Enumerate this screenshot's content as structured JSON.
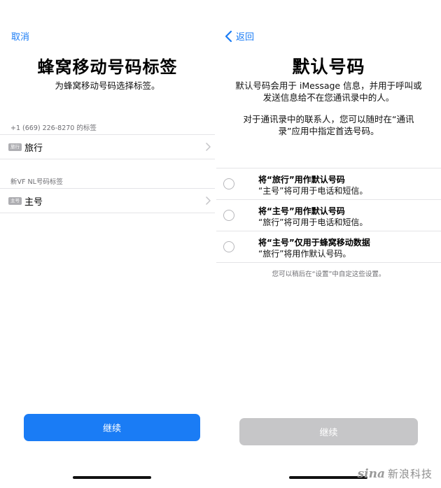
{
  "left": {
    "cancel_label": "取消",
    "title": "蜂窝移动号码标签",
    "subtitle": "为蜂窝移动号码选择标签。",
    "line1": {
      "section_label": "+1 (669) 226-8270 的标签",
      "chip": "旅行",
      "value": "旅行"
    },
    "line2": {
      "section_label": "新VF NL号码标签",
      "chip": "主号",
      "value": "主号"
    },
    "continue_label": "继续"
  },
  "right": {
    "back_label": "返回",
    "title": "默认号码",
    "desc1_line1": "默认号码会用于 iMessage 信息，并用于呼叫或",
    "desc1_line2": "发送信息给不在您通讯录中的人。",
    "desc2_line1": "对于通讯录中的联系人，您可以随时在“通讯",
    "desc2_line2": "录”应用中指定首选号码。",
    "options": [
      {
        "title": "将“旅行”用作默认号码",
        "detail": "“主号”将可用于电话和短信。"
      },
      {
        "title": "将“主号”用作默认号码",
        "detail": "“旅行”将可用于电话和短信。"
      },
      {
        "title": "将“主号”仅用于蜂窝移动数据",
        "detail": "“旅行”将用作默认号码。"
      }
    ],
    "footnote": "您可以稍后在“设置”中自定这些设置。",
    "continue_label": "继续"
  },
  "watermark": {
    "logo": "sina",
    "text": "新浪科技"
  },
  "colors": {
    "accent": "#1a7cf5",
    "disabled": "#c6c6c8",
    "separator": "#e4e4e7",
    "secondary_text": "#6d6d72"
  },
  "icons": {
    "back": "chevron-left-icon",
    "disclosure": "chevron-right-icon",
    "radio": "radio-unselected-icon"
  }
}
